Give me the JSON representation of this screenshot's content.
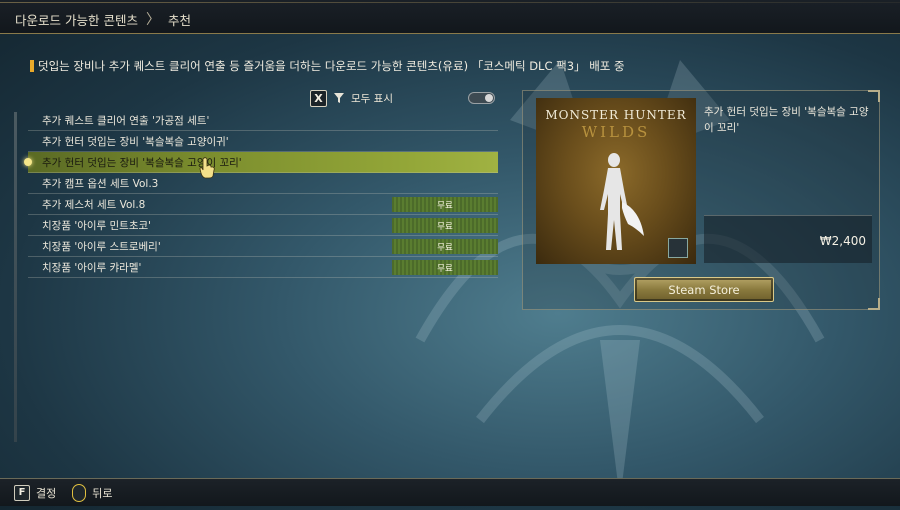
{
  "breadcrumb": {
    "root": "다운로드 가능한 콘텐츠",
    "current": "추천"
  },
  "description": "덧입는 장비나 추가 퀘스트 클리어 연출 등 즐거움을 더하는 다운로드 가능한 콘텐츠(유료) 「코스메틱 DLC 팩3」 배포 중",
  "filter": {
    "key": "X",
    "label": "모두 표시",
    "enabled": false
  },
  "list": {
    "items": [
      {
        "label": "추가 퀘스트 클리어 연출 '가공점 세트'",
        "tag": ""
      },
      {
        "label": "추가 헌터 덧입는 장비 '복슬복슬 고양이귀'",
        "tag": ""
      },
      {
        "label": "추가 헌터 덧입는 장비 '복슬복슬 고양이 꼬리'",
        "tag": "",
        "selected": true
      },
      {
        "label": "추가 캠프 옵션 세트 Vol.3",
        "tag": ""
      },
      {
        "label": "추가 제스처 세트 Vol.8",
        "tag": "무료"
      },
      {
        "label": "치장품 '아이루 민트초코'",
        "tag": "무료"
      },
      {
        "label": "치장품 '아이루 스트로베리'",
        "tag": "무료"
      },
      {
        "label": "치장품 '아이루 캬라멜'",
        "tag": "무료"
      }
    ]
  },
  "detail": {
    "logo_line1": "MONSTER HUNTER",
    "logo_line2": "WILDS",
    "title": "추가 헌터 덧입는 장비 '복슬복슬 고양이 꼬리'",
    "price": "₩2,400",
    "store_button": "Steam Store"
  },
  "hints": [
    {
      "key": "F",
      "label": "결정"
    },
    {
      "key": "mouse-right-icon",
      "label": "뒤로"
    }
  ],
  "colors": {
    "selected": "#93a638",
    "accent": "#e8a92a",
    "free_tag": "#5a7d30"
  }
}
